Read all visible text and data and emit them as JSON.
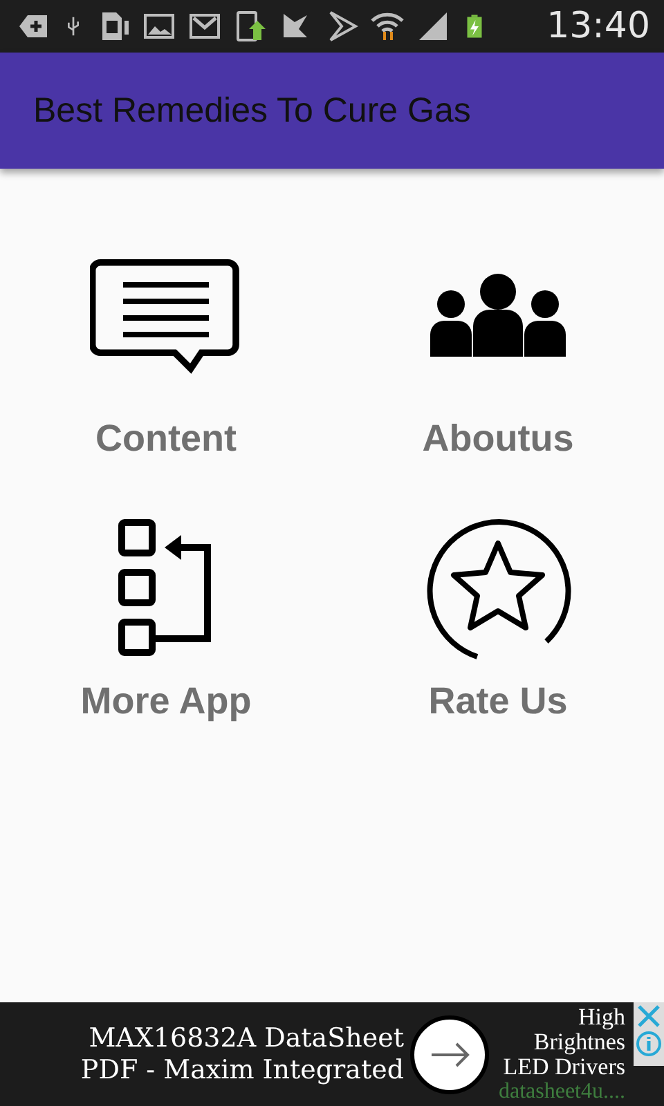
{
  "status_bar": {
    "time": "13:40"
  },
  "app_bar": {
    "title": "Best Remedies To Cure Gas"
  },
  "menu": [
    {
      "kind": "content",
      "label": "Content"
    },
    {
      "kind": "about",
      "label": "Aboutus"
    },
    {
      "kind": "more",
      "label": "More App"
    },
    {
      "kind": "rate",
      "label": "Rate Us"
    }
  ],
  "ad": {
    "headline": "MAX16832A DataSheet PDF - Maxim Integrated",
    "side_lines": [
      "High",
      "Brightnes",
      "LED Drivers"
    ],
    "source": "datasheet4u...."
  }
}
